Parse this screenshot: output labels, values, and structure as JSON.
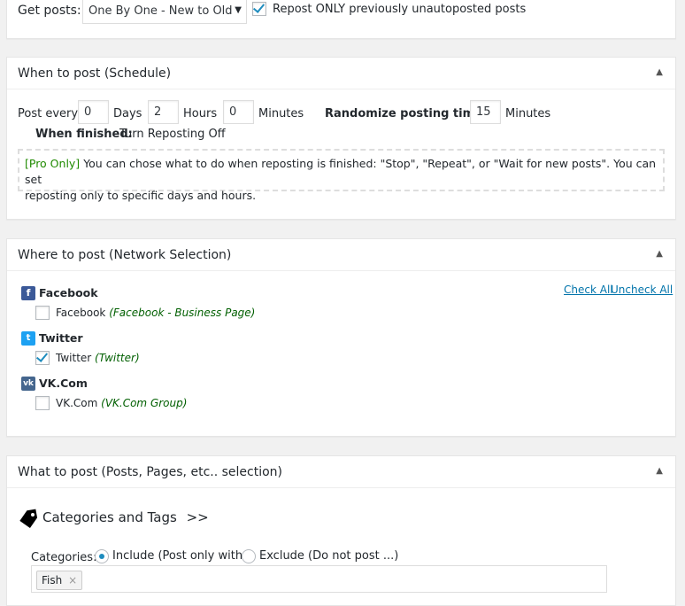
{
  "get_posts": {
    "label": "Get posts:",
    "select_value": "One By One - New to Old",
    "repost_checked": true,
    "repost_label": "Repost ONLY previously unautoposted posts"
  },
  "schedule": {
    "title": "When to post (Schedule)",
    "post_every_label": "Post every:",
    "days_value": "0",
    "days_label": "Days",
    "hours_value": "2",
    "hours_label": "Hours",
    "minutes_value": "0",
    "minutes_label": "Minutes",
    "randomize_label": "Randomize posting time: ±",
    "randomize_value": "15",
    "randomize_unit": "Minutes",
    "when_finished_label": "When finished:",
    "when_finished_value": "Turn Reposting Off",
    "pro_tag": "[Pro Only]",
    "pro_text_1": "You can chose what to do when reposting is finished: \"Stop\", \"Repeat\", or \"Wait for new posts\". You can set",
    "pro_text_2": "reposting only to specific days and hours."
  },
  "networks": {
    "title": "Where to post (Network Selection)",
    "check_all": "Check All",
    "uncheck_all": "Uncheck All",
    "items": [
      {
        "name": "Facebook",
        "icon": "facebook-icon",
        "color": "#3b5998",
        "account": "Facebook",
        "account_type": "(Facebook - Business Page)",
        "checked": false
      },
      {
        "name": "Twitter",
        "icon": "twitter-icon",
        "color": "#1da1f2",
        "account": "Twitter",
        "account_type": "(Twitter)",
        "checked": true
      },
      {
        "name": "VK.Com",
        "icon": "vk-icon",
        "color": "#45668e",
        "account": "VK.Com",
        "account_type": "(VK.Com Group)",
        "checked": false
      }
    ]
  },
  "what_to_post": {
    "title": "What to post (Posts, Pages, etc.. selection)",
    "cat_tags_heading": "Categories and Tags",
    "cat_tags_arrow": ">>",
    "categories_label": "Categories:",
    "include_label": "Include (Post only with..)",
    "exclude_label": "Exclude (Do not post ...)",
    "include_selected": true,
    "tag_token": "Fish",
    "tag_remove": "×"
  }
}
